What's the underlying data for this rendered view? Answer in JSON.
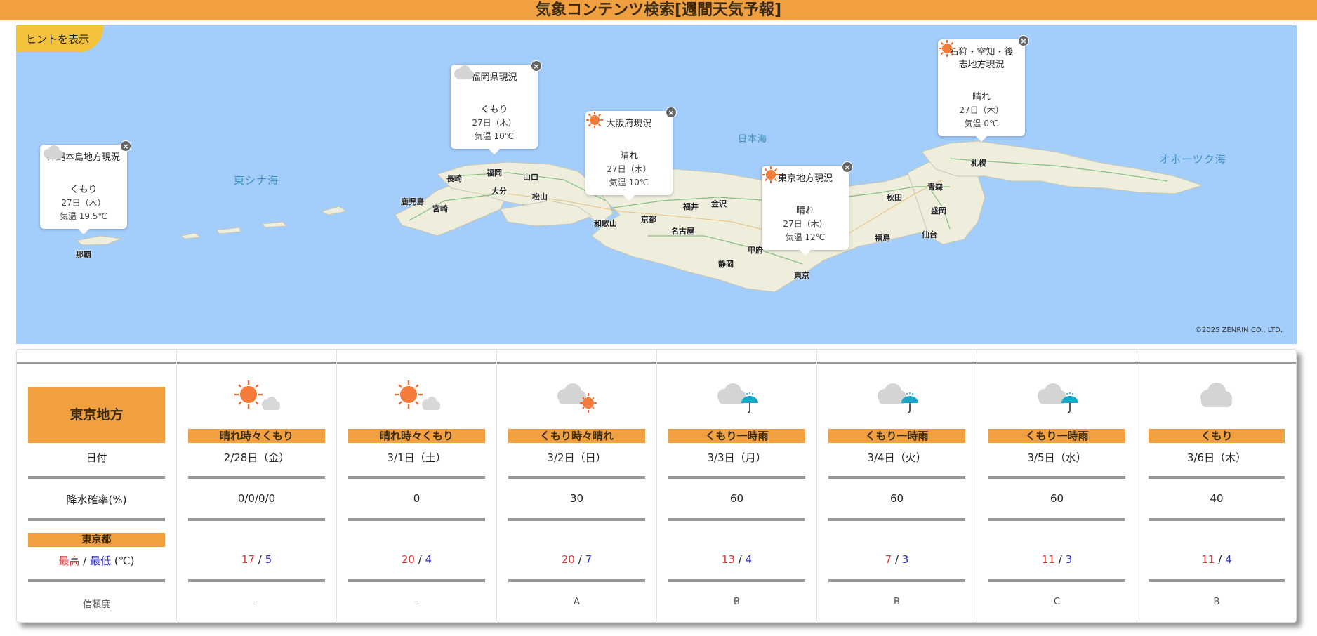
{
  "header": {
    "title": "気象コンテンツ検索[週間天気予報]"
  },
  "map": {
    "hint_label": "ヒントを表示",
    "copyright": "©2025 ZENRIN CO., LTD.",
    "sea_labels": [
      "東シナ海",
      "日本海",
      "オホーツク海"
    ],
    "cities": [
      "那覇",
      "鹿児島",
      "宮崎",
      "長崎",
      "福岡",
      "大分",
      "山口",
      "松山",
      "和歌山",
      "京都",
      "福井",
      "金沢",
      "名古屋",
      "甲府",
      "静岡",
      "東京",
      "秋田",
      "盛岡",
      "青森",
      "福島",
      "仙台",
      "札幌"
    ],
    "popups": [
      {
        "title": "沖縄本島地方現況",
        "icon": "cloud-icon",
        "condition": "くもり",
        "date": "27日（木）",
        "temp": "気温 19.5℃"
      },
      {
        "title": "福岡県現況",
        "icon": "cloud-icon",
        "condition": "くもり",
        "date": "27日（木）",
        "temp": "気温 10℃"
      },
      {
        "title": "大阪府現況",
        "icon": "sun-icon",
        "condition": "晴れ",
        "date": "27日（木）",
        "temp": "気温 10℃"
      },
      {
        "title": "東京地方現況",
        "icon": "sun-icon",
        "condition": "晴れ",
        "date": "27日（木）",
        "temp": "気温 12℃"
      },
      {
        "title": "石狩・空知・後志地方現況",
        "icon": "sun-icon",
        "condition": "晴れ",
        "date": "27日（木）",
        "temp": "気温 0℃"
      }
    ],
    "close_symbol": "×"
  },
  "forecast": {
    "area": "東京地方",
    "row_labels": {
      "date": "日付",
      "pop": "降水確率(%)",
      "pref": "東京都",
      "hi": "最高",
      "slash": " / ",
      "lo": "最低",
      "unit": " (℃)",
      "reliability": "信頼度"
    },
    "days": [
      {
        "condition": "晴れ時々くもり",
        "icon": "sun-cloud-icon",
        "date": "2/28日（金）",
        "pop": "0/0/0/0",
        "hi": "17",
        "lo": "5",
        "reliability": "-"
      },
      {
        "condition": "晴れ時々くもり",
        "icon": "sun-cloud-icon",
        "date": "3/1日（土）",
        "pop": "0",
        "hi": "20",
        "lo": "4",
        "reliability": "-"
      },
      {
        "condition": "くもり時々晴れ",
        "icon": "cloud-sun-icon",
        "date": "3/2日（日）",
        "pop": "30",
        "hi": "20",
        "lo": "7",
        "reliability": "A"
      },
      {
        "condition": "くもり一時雨",
        "icon": "cloud-umbrella-icon",
        "date": "3/3日（月）",
        "pop": "60",
        "hi": "13",
        "lo": "4",
        "reliability": "B"
      },
      {
        "condition": "くもり一時雨",
        "icon": "cloud-umbrella-icon",
        "date": "3/4日（火）",
        "pop": "60",
        "hi": "7",
        "lo": "3",
        "reliability": "B"
      },
      {
        "condition": "くもり一時雨",
        "icon": "cloud-umbrella-icon",
        "date": "3/5日（水）",
        "pop": "60",
        "hi": "11",
        "lo": "3",
        "reliability": "C"
      },
      {
        "condition": "くもり",
        "icon": "cloud-icon",
        "date": "3/6日（木）",
        "pop": "40",
        "hi": "11",
        "lo": "4",
        "reliability": "B"
      }
    ]
  },
  "colors": {
    "accent": "#f0a040",
    "sea": "#a3cdfb",
    "high": "#e53030",
    "low": "#3030d0",
    "hint": "#f4c23a"
  }
}
